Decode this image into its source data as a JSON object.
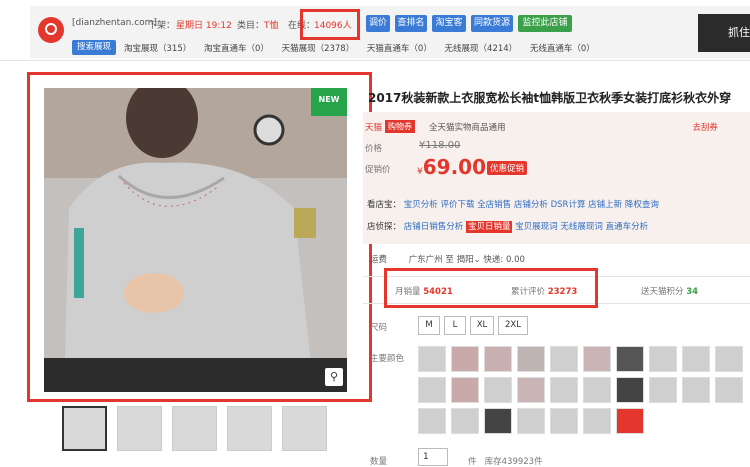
{
  "topbar": {
    "shop_url": "[dianzhentan.com]",
    "listed_label": "下架：",
    "listed_value": "星期日 19:12",
    "category_label": "类目：",
    "category_value": "T恤",
    "online_label": "在线：",
    "online_value": "14096人",
    "buttons": [
      "调价",
      "查排名",
      "淘宝客",
      "同款货源"
    ],
    "monitor_button": "监控此店铺",
    "search_button": "搜索展现",
    "stats": [
      "淘宝展现（315）",
      "淘宝直通车（0）",
      "天猫展现（2378）",
      "天猫直通车（0）",
      "无线展现（4214）",
      "无线直通车（0）"
    ],
    "right_thumb_text": "抓住"
  },
  "product": {
    "title": "2017秋装新款上衣服宽松长袖t恤韩版卫衣秋季女装打底衫秋衣外穿",
    "new_badge": "NEW",
    "zoom_icon": "magnifier-icon",
    "tmall_tag": "天猫",
    "shopping_voucher": "购物券",
    "guarantee": "全天猫实物商品通用",
    "coupon_link": "去刮券",
    "price_label": "价格",
    "old_price": "¥118.00",
    "promo_price_label": "促销价",
    "promo_currency": "¥",
    "promo_price": "69.00",
    "promo_badge": "优惠促销",
    "tools_label": "看店宝：",
    "tools": [
      "宝贝分析",
      "评价下载",
      "全店销售",
      "店铺分析",
      "DSR计算",
      "店铺上新",
      "降权查询"
    ],
    "spy_label": "店侦探：",
    "spy_tools_before": "店铺日销售分析",
    "spy_highlight": "宝贝日销量",
    "spy_tools_after": [
      "宝贝展现词",
      "无线展现词",
      "直通车分析"
    ],
    "ship_label": "运费",
    "ship_from": "广东广州",
    "ship_to_label": "至",
    "ship_to": "揭阳",
    "express": "快递: 0.00",
    "monthly_sales_label": "月销量",
    "monthly_sales": "54021",
    "reviews_label": "累计评价",
    "reviews": "23273",
    "points_label": "送天猫积分",
    "points": "34",
    "size_label": "尺码",
    "sizes": [
      "M",
      "L",
      "XL",
      "2XL"
    ],
    "color_label": "主要颜色",
    "qty_label": "数量",
    "qty_value": "1",
    "qty_unit": "件",
    "stock": "库存439923件"
  },
  "colors": {
    "accent_red": "#e3372d",
    "button_blue": "#3a7bd5",
    "button_green": "#3aa04a"
  }
}
